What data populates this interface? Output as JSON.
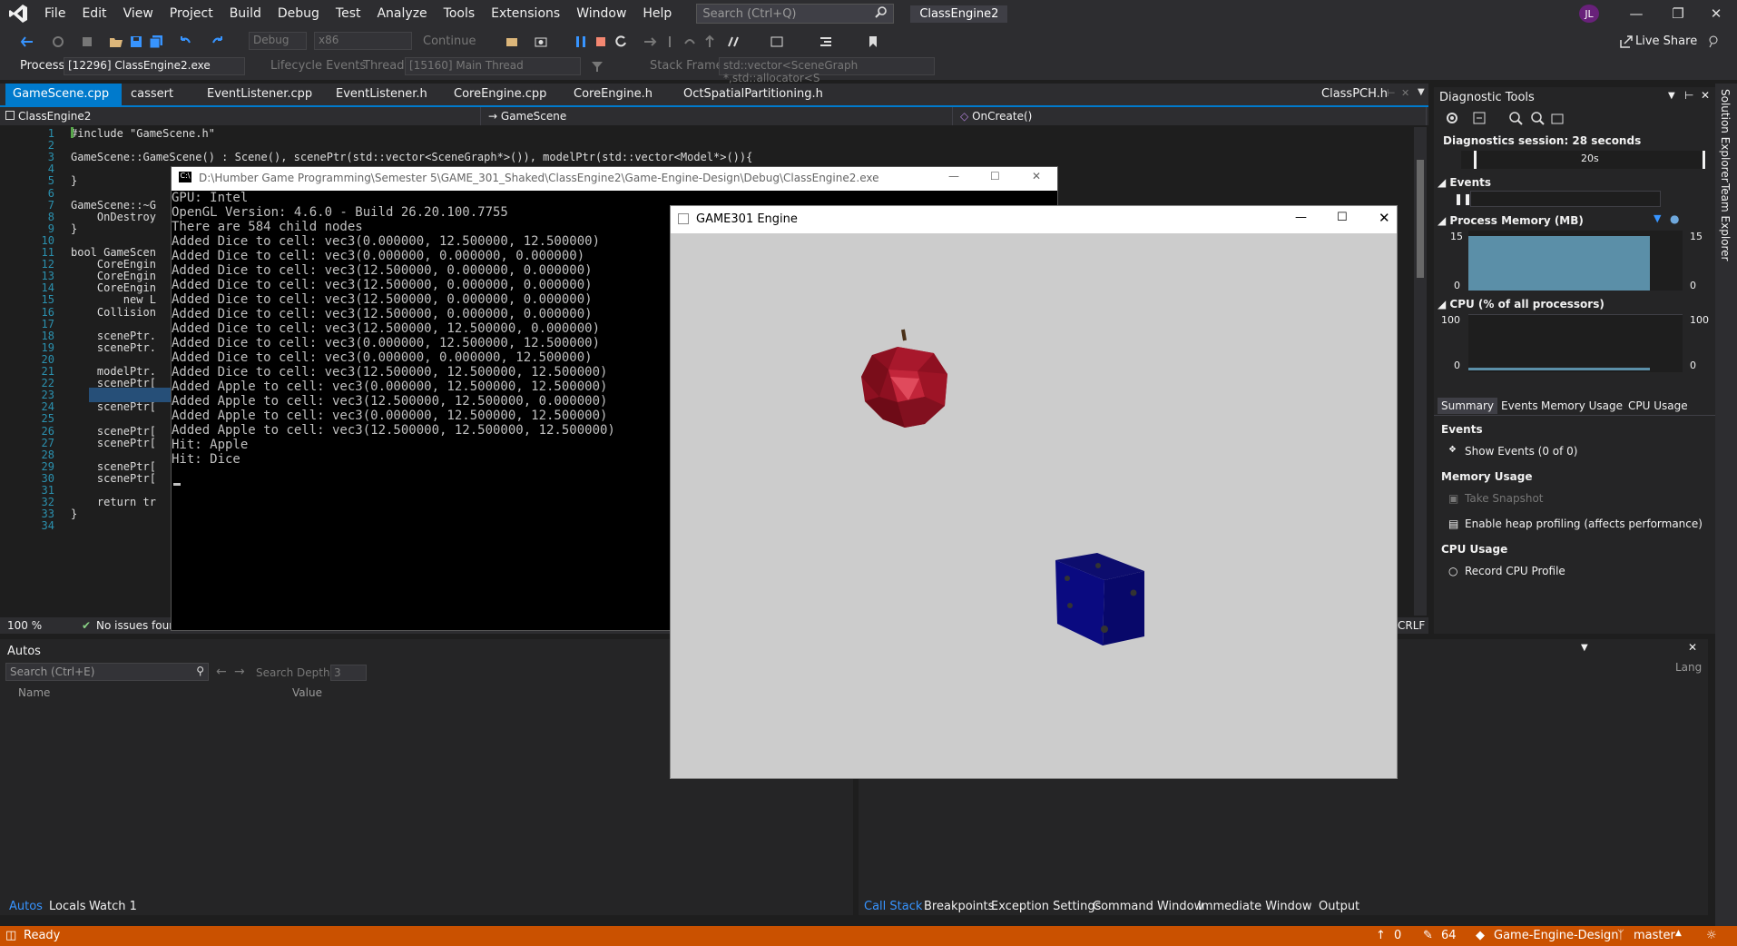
{
  "menu": {
    "items": [
      "File",
      "Edit",
      "View",
      "Project",
      "Build",
      "Debug",
      "Test",
      "Analyze",
      "Tools",
      "Extensions",
      "Window",
      "Help"
    ],
    "search_placeholder": "Search (Ctrl+Q)",
    "solution_name": "ClassEngine2",
    "avatar_initials": "JL"
  },
  "toolbar": {
    "config": "Debug",
    "platform": "x86",
    "continue_label": "Continue",
    "live_share": "Live Share",
    "process_label": "Process:",
    "process_value": "[12296] ClassEngine2.exe",
    "lifecycle_label": "Lifecycle Events",
    "thread_label": "Thread:",
    "thread_value": "[15160] Main Thread",
    "stack_frame_label": "Stack Frame:",
    "stack_frame_value": "std::vector<SceneGraph *,std::allocator<S"
  },
  "tabs": [
    {
      "label": "GameScene.cpp",
      "active": true
    },
    {
      "label": "cassert",
      "active": false
    },
    {
      "label": "EventListener.cpp",
      "active": false
    },
    {
      "label": "EventListener.h",
      "active": false
    },
    {
      "label": "CoreEngine.cpp",
      "active": false
    },
    {
      "label": "CoreEngine.h",
      "active": false
    },
    {
      "label": "OctSpatialPartitioning.h",
      "active": false
    },
    {
      "label": "ClassPCH.h",
      "active": false
    }
  ],
  "navbar": {
    "project": "ClassEngine2",
    "scope": "GameScene",
    "member": "OnCreate()"
  },
  "editor": {
    "lines": [
      {
        "n": "1",
        "code": "#include \"GameScene.h\""
      },
      {
        "n": "2",
        "code": ""
      },
      {
        "n": "3",
        "code": "GameScene::GameScene() : Scene(), scenePtr(std::vector<SceneGraph*>()), modelPtr(std::vector<Model*>()){"
      },
      {
        "n": "4",
        "code": ""
      },
      {
        "n": "5",
        "code": "}"
      },
      {
        "n": "6",
        "code": ""
      },
      {
        "n": "7",
        "code": "GameScene::~G"
      },
      {
        "n": "8",
        "code": "    OnDestroy"
      },
      {
        "n": "9",
        "code": "}"
      },
      {
        "n": "10",
        "code": ""
      },
      {
        "n": "11",
        "code": "bool GameScen"
      },
      {
        "n": "12",
        "code": "    CoreEngin"
      },
      {
        "n": "13",
        "code": "    CoreEngin"
      },
      {
        "n": "14",
        "code": "    CoreEngin"
      },
      {
        "n": "15",
        "code": "        new L"
      },
      {
        "n": "16",
        "code": "    Collision"
      },
      {
        "n": "17",
        "code": ""
      },
      {
        "n": "18",
        "code": "    scenePtr."
      },
      {
        "n": "19",
        "code": "    scenePtr."
      },
      {
        "n": "20",
        "code": ""
      },
      {
        "n": "21",
        "code": "    modelPtr."
      },
      {
        "n": "22",
        "code": "    scenePtr["
      },
      {
        "n": "23",
        "code": "    modelPtr."
      },
      {
        "n": "24",
        "code": "    scenePtr["
      },
      {
        "n": "25",
        "code": ""
      },
      {
        "n": "26",
        "code": "    scenePtr["
      },
      {
        "n": "27",
        "code": "    scenePtr["
      },
      {
        "n": "28",
        "code": ""
      },
      {
        "n": "29",
        "code": "    scenePtr["
      },
      {
        "n": "30",
        "code": "    scenePtr["
      },
      {
        "n": "31",
        "code": ""
      },
      {
        "n": "32",
        "code": "    return tr"
      },
      {
        "n": "33",
        "code": "}"
      },
      {
        "n": "34",
        "code": ""
      }
    ],
    "zoom": "100 %",
    "issues": "No issues found",
    "line_ending": "CRLF"
  },
  "console": {
    "title": "D:\\Humber Game Programming\\Semester 5\\GAME_301_Shaked\\ClassEngine2\\Game-Engine-Design\\Debug\\ClassEngine2.exe",
    "output": [
      "GPU: Intel",
      "OpenGL Version: 4.6.0 - Build 26.20.100.7755",
      "There are 584 child nodes",
      "Added Dice to cell: vec3(0.000000, 12.500000, 12.500000)",
      "Added Dice to cell: vec3(0.000000, 0.000000, 0.000000)",
      "Added Dice to cell: vec3(12.500000, 0.000000, 0.000000)",
      "Added Dice to cell: vec3(12.500000, 0.000000, 0.000000)",
      "Added Dice to cell: vec3(12.500000, 0.000000, 0.000000)",
      "Added Dice to cell: vec3(12.500000, 0.000000, 0.000000)",
      "Added Dice to cell: vec3(12.500000, 12.500000, 0.000000)",
      "Added Dice to cell: vec3(0.000000, 12.500000, 12.500000)",
      "Added Dice to cell: vec3(0.000000, 0.000000, 12.500000)",
      "Added Dice to cell: vec3(12.500000, 12.500000, 12.500000)",
      "Added Apple to cell: vec3(0.000000, 12.500000, 12.500000)",
      "Added Apple to cell: vec3(12.500000, 12.500000, 0.000000)",
      "Added Apple to cell: vec3(0.000000, 12.500000, 12.500000)",
      "Added Apple to cell: vec3(12.500000, 12.500000, 12.500000)",
      "Hit: Apple",
      "Hit: Dice"
    ]
  },
  "game": {
    "title": "GAME301 Engine"
  },
  "diagnostics": {
    "title": "Diagnostic Tools",
    "session": "Diagnostics session: 28 seconds",
    "timeline_label": "20s",
    "events_header": "Events",
    "memory_header": "Process Memory (MB)",
    "memory_max": "15",
    "memory_min": "0",
    "cpu_header": "CPU (% of all processors)",
    "cpu_max": "100",
    "cpu_min": "0",
    "tabs": [
      "Summary",
      "Events",
      "Memory Usage",
      "CPU Usage"
    ],
    "events_section": "Events",
    "show_events": "Show Events (0 of 0)",
    "memory_section": "Memory Usage",
    "take_snapshot": "Take Snapshot",
    "heap_profiling": "Enable heap profiling (affects performance)",
    "cpu_section": "CPU Usage",
    "record_cpu": "Record CPU Profile"
  },
  "autos": {
    "title": "Autos",
    "search_placeholder": "Search (Ctrl+E)",
    "search_depth_label": "Search Depth:",
    "search_depth_value": "3",
    "col_name": "Name",
    "col_value": "Value",
    "tabs": [
      "Autos",
      "Locals",
      "Watch 1"
    ]
  },
  "callstack": {
    "col_lang": "Lang",
    "tabs": [
      "Call Stack",
      "Breakpoints",
      "Exception Settings",
      "Command Window",
      "Immediate Window",
      "Output"
    ]
  },
  "side_tabs": [
    "Solution Explorer",
    "Team Explorer"
  ],
  "status": {
    "ready": "Ready",
    "errors": "0",
    "changes": "64",
    "repo": "Game-Engine-Design",
    "branch": "master"
  },
  "colors": {
    "accent": "#007acc",
    "status_bar": "#ca5100",
    "apple": "#b0182a",
    "dice": "#0a0a7a"
  }
}
